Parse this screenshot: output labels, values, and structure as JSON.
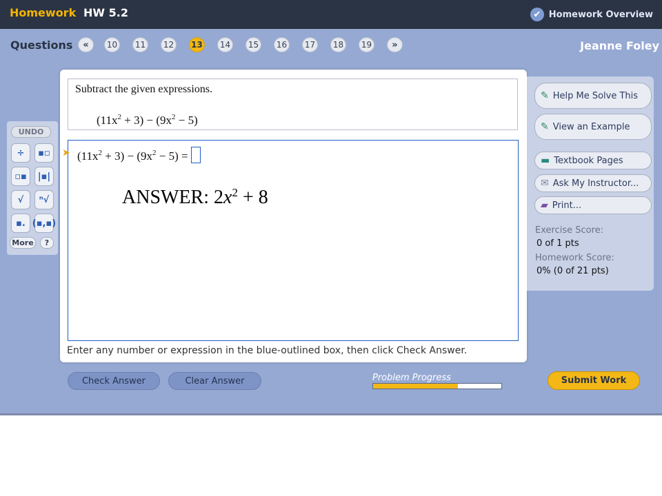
{
  "header": {
    "brand": "Homework",
    "assignment": "HW 5.2",
    "overview_label": "Homework Overview",
    "overview_icon": "check-icon"
  },
  "questions": {
    "label": "Questions",
    "prev": "«",
    "next": "»",
    "numbers": [
      "10",
      "11",
      "12",
      "13",
      "14",
      "15",
      "16",
      "17",
      "18",
      "19"
    ],
    "current": "13"
  },
  "student": "Jeanne Foley",
  "tools": {
    "undo": "UNDO",
    "more": "More",
    "help": "?",
    "icons": [
      "fraction-icon",
      "mixed-number-icon",
      "exponent-icon",
      "absolute-value-icon",
      "square-root-icon",
      "nth-root-icon",
      "subscript-icon",
      "ordered-pair-icon"
    ]
  },
  "problem": {
    "instruction": "Subtract the given expressions.",
    "expression_a": "(11x",
    "expression_b": " + 3) − (9x",
    "expression_c": " − 5)",
    "exp": "2",
    "equation_end": " − 5) =",
    "answer_prefix": "ANSWER: 2",
    "answer_var": "x",
    "answer_exp": "2",
    "answer_suffix": " + 8"
  },
  "hint": "Enter any number or expression in the blue-outlined box, then click Check Answer.",
  "sidebar": {
    "help_me_solve": "Help Me Solve This",
    "view_example": "View an Example",
    "textbook": "Textbook Pages",
    "ask_instructor": "Ask My Instructor...",
    "print": "Print...",
    "exercise_score_label": "Exercise Score:",
    "exercise_score": "0 of 1 pts",
    "homework_score_label": "Homework Score:",
    "homework_score": "0% (0 of 21 pts)"
  },
  "footer": {
    "check_answer": "Check Answer",
    "clear_answer": "Clear Answer",
    "progress_label": "Problem Progress",
    "progress": 0.66,
    "submit": "Submit Work"
  },
  "colors": {
    "topbar": "#2b3444",
    "background": "#95a9d3",
    "accent": "#f3b816",
    "answer_outline": "#1f5cc5"
  }
}
